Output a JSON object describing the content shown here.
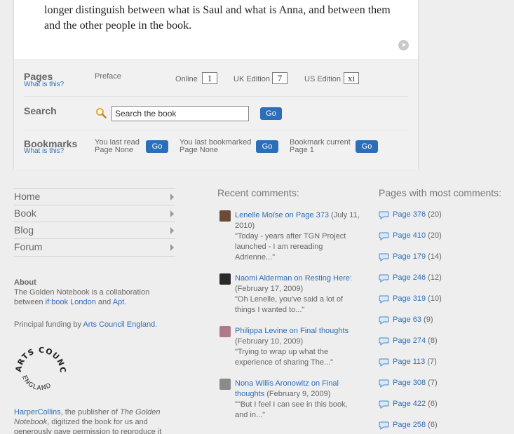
{
  "book_text": "longer distinguish between what is Saul and what is Anna, and between them and the other people in the book.",
  "pages": {
    "heading": "Pages",
    "help_link": "What is this?",
    "preface_label": "Preface",
    "online_label": "Online",
    "online_value": "1",
    "uk_label": "UK Edition",
    "uk_value": "7",
    "us_label": "US Edition",
    "us_value": "xi"
  },
  "search": {
    "heading": "Search",
    "value": "Search the book",
    "go": "Go"
  },
  "bookmarks": {
    "heading": "Bookmarks",
    "help_link": "What is this?",
    "last_read_label": "You last read",
    "last_read_value": "Page None",
    "last_bookmarked_label": "You last bookmarked",
    "last_bookmarked_value": "Page None",
    "current_label": "Bookmark current",
    "current_value": "Page 1",
    "go": "Go"
  },
  "nav": [
    {
      "label": "Home"
    },
    {
      "label": "Book"
    },
    {
      "label": "Blog"
    },
    {
      "label": "Forum"
    }
  ],
  "about": {
    "heading": "About",
    "text_1": "The Golden Notebook is a collaboration between ",
    "link_1": "if:book London",
    "text_2": " and ",
    "link_2": "Apt",
    "text_3": ".",
    "funding_text": "Principal funding by ",
    "funding_link": "Arts Council England",
    "funding_end": ".",
    "logo_top": "ARTS COUNCIL",
    "logo_bottom": "ENGLAND",
    "publisher_link": "HarperCollins",
    "publisher_text_1": ", the publisher of ",
    "publisher_italic": "The Golden Notebook",
    "publisher_text_2": ", digitized the book for us and generously gave permission to reproduce it"
  },
  "recent": {
    "title": "Recent comments:",
    "items": [
      {
        "author": "Lenelle Moïse",
        "on": " on ",
        "page": "Page 373",
        "date": " (July 11, 2010)",
        "excerpt": "\"Today - years after TGN Project launched - I am rereading Adrienne...\""
      },
      {
        "author": "Naomi Alderman",
        "on": " on ",
        "page": "Resting Here:",
        "date": " (February 17, 2009)",
        "excerpt": "\"Oh Lenelle, you've said a lot of things I wanted to...\""
      },
      {
        "author": "Philippa Levine",
        "on": " on ",
        "page": "Final thoughts",
        "date": " (February 10, 2009)",
        "excerpt": "\"Trying to wrap up what the experience of sharing The...\""
      },
      {
        "author": "Nona Willis Aronowitz",
        "on": " on ",
        "page": "Final thoughts",
        "date": " (February 9, 2009)",
        "excerpt": "\"\"But I feel I can see in this book, and in...\""
      }
    ]
  },
  "most": {
    "title": "Pages with most comments:",
    "items": [
      {
        "page": "Page 376",
        "count": " (20)"
      },
      {
        "page": "Page 410",
        "count": " (20)"
      },
      {
        "page": "Page 179",
        "count": " (14)"
      },
      {
        "page": "Page 246",
        "count": " (12)"
      },
      {
        "page": "Page 319",
        "count": " (10)"
      },
      {
        "page": "Page 63",
        "count": " (9)"
      },
      {
        "page": "Page 274",
        "count": " (8)"
      },
      {
        "page": "Page 113",
        "count": " (7)"
      },
      {
        "page": "Page 308",
        "count": " (7)"
      },
      {
        "page": "Page 422",
        "count": " (6)"
      },
      {
        "page": "Page 258",
        "count": " (6)"
      }
    ]
  },
  "colors": {
    "link": "#2c6fb8",
    "go_button": "#2c6fb8",
    "page_bg": "#eeeeee",
    "card_bg": "#ffffff"
  }
}
